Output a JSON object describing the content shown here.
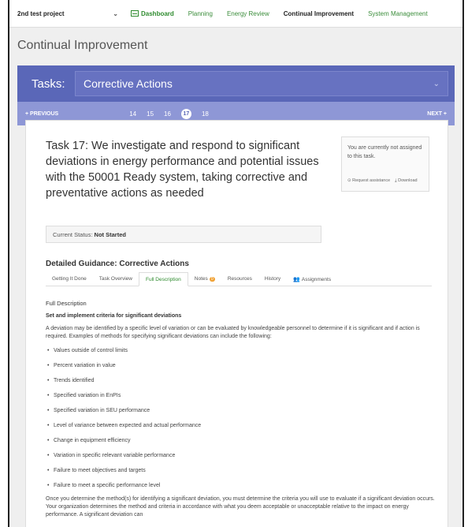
{
  "nav": {
    "project": "2nd test project",
    "items": [
      "Dashboard",
      "Planning",
      "Energy Review",
      "Continual Improvement",
      "System Management"
    ]
  },
  "page_title": "Continual Improvement",
  "tasks": {
    "label": "Tasks:",
    "selected": "Corrective Actions"
  },
  "pager": {
    "prev": "+ PREVIOUS",
    "next": "NEXT +",
    "numbers": [
      "14",
      "15",
      "16",
      "17",
      "18"
    ],
    "active": "17"
  },
  "task": {
    "title": "Task 17: We investigate and respond to significant deviations in energy performance and potential issues with the 50001 Ready system, taking corrective and preventative actions as needed"
  },
  "assign": {
    "text": "You are currently not assigned to this task.",
    "request": "Request assistance",
    "download": "Download"
  },
  "status": {
    "label": "Current Status:",
    "value": "Not Started"
  },
  "guidance_title": "Detailed Guidance: Corrective Actions",
  "tabs": [
    "Getting It Done",
    "Task Overview",
    "Full Description",
    "Notes",
    "Resources",
    "History",
    "Assignments"
  ],
  "notes_badge": "0",
  "content": {
    "heading": "Full Description",
    "subheading": "Set and implement criteria for significant deviations",
    "intro": "A deviation may be identified by a specific level of variation or can be evaluated by knowledgeable personnel to determine if it is significant and if action is required. Examples of methods for specifying significant deviations can include the following:",
    "bullets": [
      "Values outside of control limits",
      "Percent variation in value",
      "Trends identified",
      "Specified variation in EnPIs",
      "Specified variation in SEU performance",
      "Level of variance between expected and actual performance",
      "Change in equipment efficiency",
      "Variation in specific relevant variable performance",
      "Failure to meet objectives and targets",
      "Failure to meet a specific performance level"
    ],
    "outro": "Once you determine the method(s) for identifying a significant deviation, you must determine the criteria you will use to evaluate if a significant deviation occurs. Your organization determines the method and criteria in accordance with what you deem acceptable or unacceptable relative to the impact on energy performance. A significant deviation can"
  }
}
